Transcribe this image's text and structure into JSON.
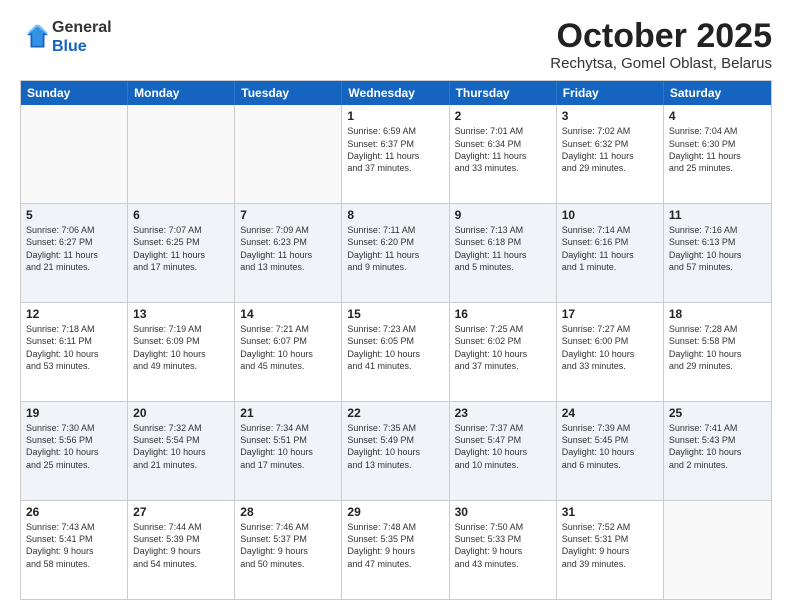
{
  "logo": {
    "general": "General",
    "blue": "Blue"
  },
  "header": {
    "month": "October 2025",
    "location": "Rechytsa, Gomel Oblast, Belarus"
  },
  "days": [
    "Sunday",
    "Monday",
    "Tuesday",
    "Wednesday",
    "Thursday",
    "Friday",
    "Saturday"
  ],
  "rows": [
    [
      {
        "day": "",
        "text": ""
      },
      {
        "day": "",
        "text": ""
      },
      {
        "day": "",
        "text": ""
      },
      {
        "day": "1",
        "text": "Sunrise: 6:59 AM\nSunset: 6:37 PM\nDaylight: 11 hours\nand 37 minutes."
      },
      {
        "day": "2",
        "text": "Sunrise: 7:01 AM\nSunset: 6:34 PM\nDaylight: 11 hours\nand 33 minutes."
      },
      {
        "day": "3",
        "text": "Sunrise: 7:02 AM\nSunset: 6:32 PM\nDaylight: 11 hours\nand 29 minutes."
      },
      {
        "day": "4",
        "text": "Sunrise: 7:04 AM\nSunset: 6:30 PM\nDaylight: 11 hours\nand 25 minutes."
      }
    ],
    [
      {
        "day": "5",
        "text": "Sunrise: 7:06 AM\nSunset: 6:27 PM\nDaylight: 11 hours\nand 21 minutes."
      },
      {
        "day": "6",
        "text": "Sunrise: 7:07 AM\nSunset: 6:25 PM\nDaylight: 11 hours\nand 17 minutes."
      },
      {
        "day": "7",
        "text": "Sunrise: 7:09 AM\nSunset: 6:23 PM\nDaylight: 11 hours\nand 13 minutes."
      },
      {
        "day": "8",
        "text": "Sunrise: 7:11 AM\nSunset: 6:20 PM\nDaylight: 11 hours\nand 9 minutes."
      },
      {
        "day": "9",
        "text": "Sunrise: 7:13 AM\nSunset: 6:18 PM\nDaylight: 11 hours\nand 5 minutes."
      },
      {
        "day": "10",
        "text": "Sunrise: 7:14 AM\nSunset: 6:16 PM\nDaylight: 11 hours\nand 1 minute."
      },
      {
        "day": "11",
        "text": "Sunrise: 7:16 AM\nSunset: 6:13 PM\nDaylight: 10 hours\nand 57 minutes."
      }
    ],
    [
      {
        "day": "12",
        "text": "Sunrise: 7:18 AM\nSunset: 6:11 PM\nDaylight: 10 hours\nand 53 minutes."
      },
      {
        "day": "13",
        "text": "Sunrise: 7:19 AM\nSunset: 6:09 PM\nDaylight: 10 hours\nand 49 minutes."
      },
      {
        "day": "14",
        "text": "Sunrise: 7:21 AM\nSunset: 6:07 PM\nDaylight: 10 hours\nand 45 minutes."
      },
      {
        "day": "15",
        "text": "Sunrise: 7:23 AM\nSunset: 6:05 PM\nDaylight: 10 hours\nand 41 minutes."
      },
      {
        "day": "16",
        "text": "Sunrise: 7:25 AM\nSunset: 6:02 PM\nDaylight: 10 hours\nand 37 minutes."
      },
      {
        "day": "17",
        "text": "Sunrise: 7:27 AM\nSunset: 6:00 PM\nDaylight: 10 hours\nand 33 minutes."
      },
      {
        "day": "18",
        "text": "Sunrise: 7:28 AM\nSunset: 5:58 PM\nDaylight: 10 hours\nand 29 minutes."
      }
    ],
    [
      {
        "day": "19",
        "text": "Sunrise: 7:30 AM\nSunset: 5:56 PM\nDaylight: 10 hours\nand 25 minutes."
      },
      {
        "day": "20",
        "text": "Sunrise: 7:32 AM\nSunset: 5:54 PM\nDaylight: 10 hours\nand 21 minutes."
      },
      {
        "day": "21",
        "text": "Sunrise: 7:34 AM\nSunset: 5:51 PM\nDaylight: 10 hours\nand 17 minutes."
      },
      {
        "day": "22",
        "text": "Sunrise: 7:35 AM\nSunset: 5:49 PM\nDaylight: 10 hours\nand 13 minutes."
      },
      {
        "day": "23",
        "text": "Sunrise: 7:37 AM\nSunset: 5:47 PM\nDaylight: 10 hours\nand 10 minutes."
      },
      {
        "day": "24",
        "text": "Sunrise: 7:39 AM\nSunset: 5:45 PM\nDaylight: 10 hours\nand 6 minutes."
      },
      {
        "day": "25",
        "text": "Sunrise: 7:41 AM\nSunset: 5:43 PM\nDaylight: 10 hours\nand 2 minutes."
      }
    ],
    [
      {
        "day": "26",
        "text": "Sunrise: 7:43 AM\nSunset: 5:41 PM\nDaylight: 9 hours\nand 58 minutes."
      },
      {
        "day": "27",
        "text": "Sunrise: 7:44 AM\nSunset: 5:39 PM\nDaylight: 9 hours\nand 54 minutes."
      },
      {
        "day": "28",
        "text": "Sunrise: 7:46 AM\nSunset: 5:37 PM\nDaylight: 9 hours\nand 50 minutes."
      },
      {
        "day": "29",
        "text": "Sunrise: 7:48 AM\nSunset: 5:35 PM\nDaylight: 9 hours\nand 47 minutes."
      },
      {
        "day": "30",
        "text": "Sunrise: 7:50 AM\nSunset: 5:33 PM\nDaylight: 9 hours\nand 43 minutes."
      },
      {
        "day": "31",
        "text": "Sunrise: 7:52 AM\nSunset: 5:31 PM\nDaylight: 9 hours\nand 39 minutes."
      },
      {
        "day": "",
        "text": ""
      }
    ]
  ]
}
